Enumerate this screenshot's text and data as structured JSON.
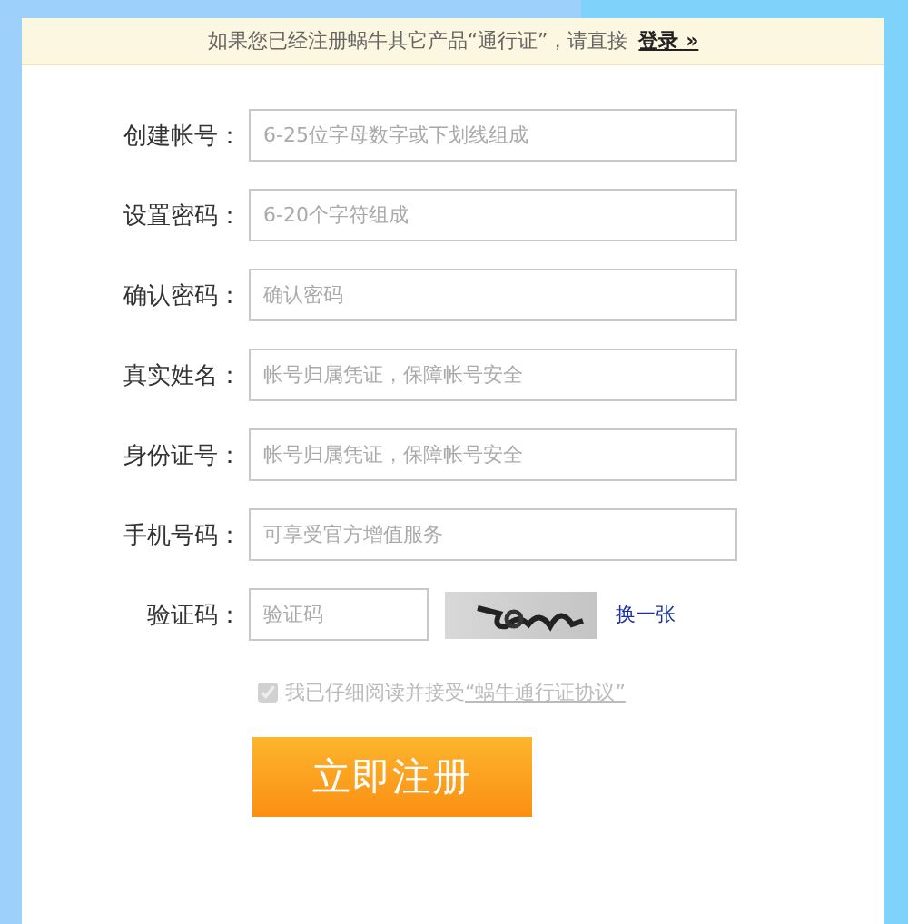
{
  "banner": {
    "text": "如果您已经注册蜗牛其它产品“通行证”，请直接",
    "link": "登录 »"
  },
  "fields": [
    {
      "label": "创建帐号：",
      "placeholder": "6-25位字母数字或下划线组成"
    },
    {
      "label": "设置密码：",
      "placeholder": "6-20个字符组成"
    },
    {
      "label": "确认密码：",
      "placeholder": "确认密码"
    },
    {
      "label": "真实姓名：",
      "placeholder": "帐号归属凭证，保障帐号安全"
    },
    {
      "label": "身份证号：",
      "placeholder": "帐号归属凭证，保障帐号安全"
    },
    {
      "label": "手机号码：",
      "placeholder": "可享受官方增值服务"
    }
  ],
  "captcha": {
    "label": "验证码：",
    "placeholder": "验证码",
    "refresh": "换一张"
  },
  "agreement": {
    "checked": true,
    "disabled": true,
    "text": "我已仔细阅读并接受",
    "link": "“蜗牛通行证协议”"
  },
  "submit": "立即注册"
}
